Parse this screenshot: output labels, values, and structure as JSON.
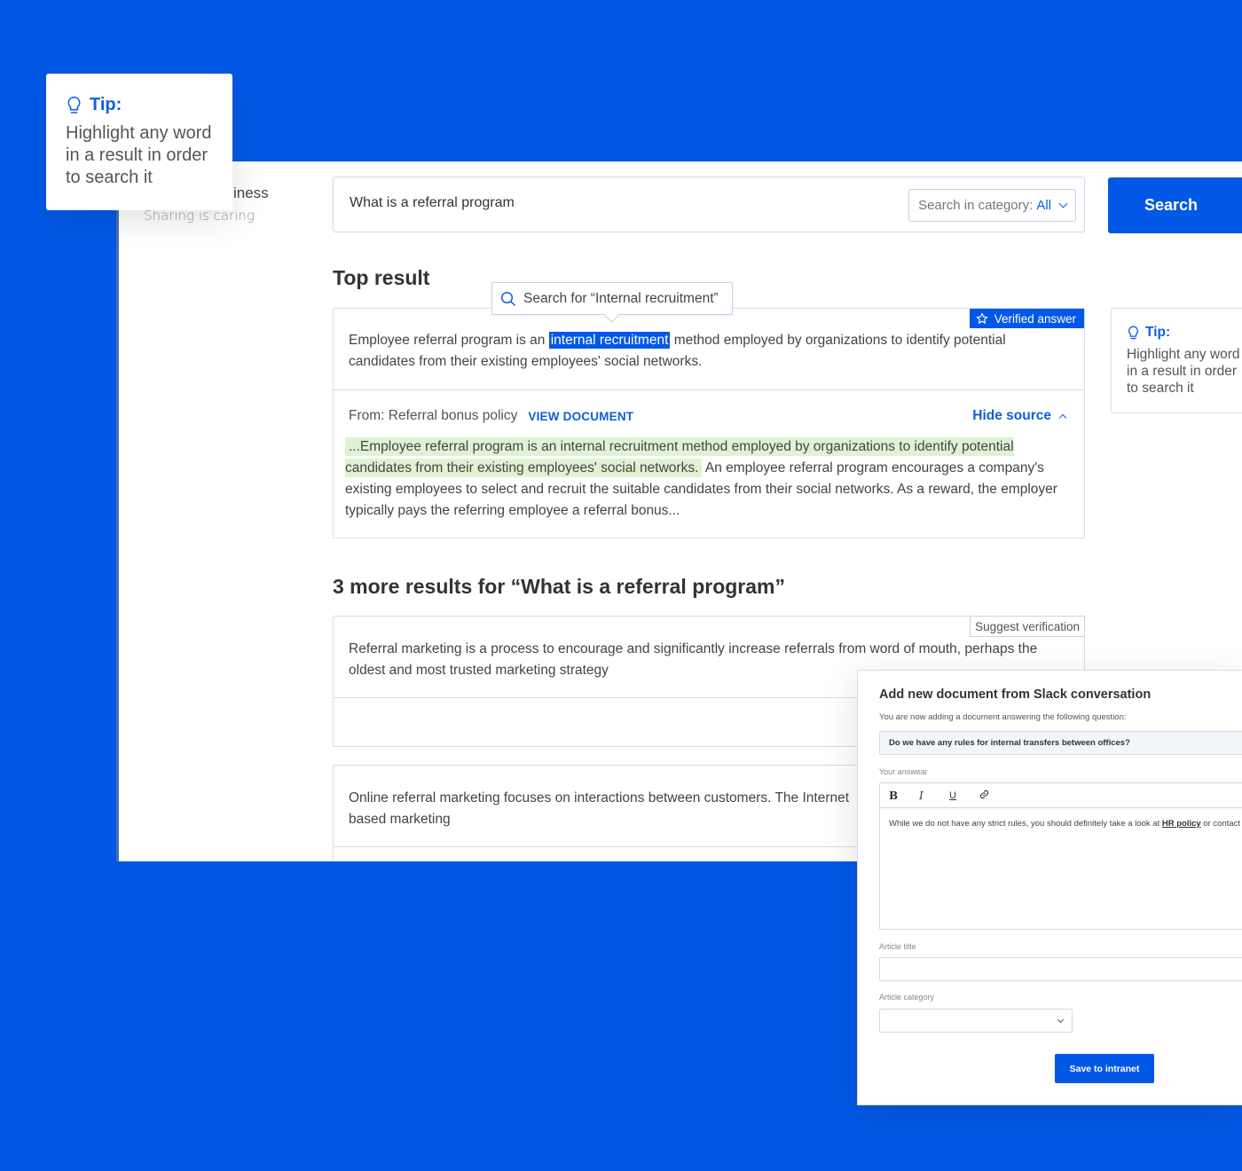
{
  "tip_float": {
    "heading": "Tip:",
    "body": "Highlight any word in a result in order to search it",
    "icon": "lightbulb-icon"
  },
  "brand": {
    "name": "iness",
    "tagline": "Sharing is caring"
  },
  "search": {
    "query": "What is a referral program",
    "category_label": "Search in category:",
    "category_value": "All",
    "button_label": "Search"
  },
  "top_result": {
    "heading": "Top result",
    "tooltip": "Search for “Internal recruitment”",
    "badge": "Verified answer",
    "answer_before": "Employee referral program is an ",
    "answer_highlight": "internal recruitment",
    "answer_after": " method employed by organizations to identify potential candidates from their existing employees' social networks.",
    "source_label": "From: Referral bonus policy",
    "view_document": "VIEW DOCUMENT",
    "hide_source": "Hide source",
    "source_highlight": "...Employee referral program is an internal recruitment method employed by organizations to identify potential candidates from their existing employees' social networks.",
    "source_rest": " An employee referral program encourages a company's existing employees to select and recruit the suitable candidates from their social networks. As a reward, the employer typically pays the referring employee a referral bonus..."
  },
  "more_results": {
    "heading": "3 more results for “What is a referral program”",
    "items": [
      {
        "text": "Referral marketing is a process to encourage and significantly increase referrals from word of mouth, perhaps the oldest and most trusted marketing strategy",
        "action": "Suggest verification"
      },
      {
        "text": "Online referral marketing focuses on interactions between customers. The Internet based marketing"
      }
    ]
  },
  "tip_side": {
    "heading": "Tip:",
    "body": "Highlight any word in a result in order to search it"
  },
  "slack_panel": {
    "title": "Add new document from Slack conversation",
    "subtitle": "You are now adding a document answering the following question:",
    "question": "Do we have any rules for internal transfers between offices?",
    "answer_label": "Your answear",
    "toolbar": [
      "B",
      "I",
      "U"
    ],
    "answer_before": "While we do not have any strict rules, you should definitely take a look at ",
    "answer_link": "HR policy",
    "answer_after": " or contact H",
    "article_title_label": "Article title",
    "article_category_label": "Article category",
    "save_label": "Save to intranet"
  },
  "colors": {
    "background": "#0258e6",
    "accent": "#0c5fe0",
    "source_highlight": "#dff3d3"
  }
}
